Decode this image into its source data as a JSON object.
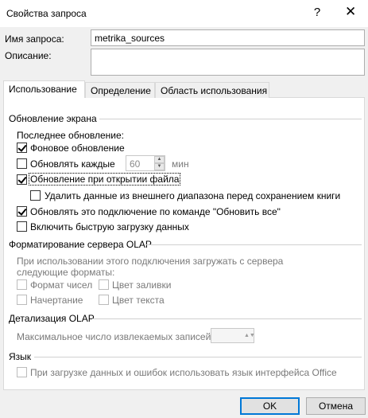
{
  "window": {
    "title": "Свойства запроса",
    "help_icon": "?",
    "close_icon": "✕"
  },
  "form": {
    "name_label": "Имя запроса:",
    "name_value": "metrika_sources",
    "description_label": "Описание:",
    "description_value": ""
  },
  "tabs": [
    {
      "label": "Использование",
      "active": true
    },
    {
      "label": "Определение",
      "active": false
    },
    {
      "label": "Область использования",
      "active": false
    }
  ],
  "usage": {
    "refresh_section": "Обновление экрана",
    "last_refresh_label": "Последнее обновление:",
    "background_refresh": {
      "label": "Фоновое обновление",
      "checked": true
    },
    "refresh_every": {
      "label": "Обновлять каждые",
      "checked": false,
      "value": "60",
      "unit": "мин"
    },
    "refresh_on_open": {
      "label": "Обновление при открытии файла",
      "checked": true
    },
    "remove_external": {
      "label": "Удалить данные из внешнего диапазона перед сохранением книги",
      "checked": false
    },
    "refresh_all": {
      "label": "Обновлять это подключение по команде \"Обновить все\"",
      "checked": true
    },
    "fast_load": {
      "label": "Включить быструю загрузку данных",
      "checked": false
    },
    "olap_format_section": "Форматирование сервера OLAP",
    "olap_format_desc": "При использовании этого подключения загружать с сервера следующие форматы:",
    "number_format": "Формат чисел",
    "fill_color": "Цвет заливки",
    "font_style": "Начертание",
    "text_color": "Цвет текста",
    "olap_drill_section": "Детализация OLAP",
    "max_records_label": "Максимальное число извлекаемых записей:",
    "max_records_value": "",
    "language_section": "Язык",
    "language_option": "При загрузке данных и ошибок использовать язык интерфейса Office"
  },
  "buttons": {
    "ok": "OK",
    "cancel": "Отмена"
  }
}
